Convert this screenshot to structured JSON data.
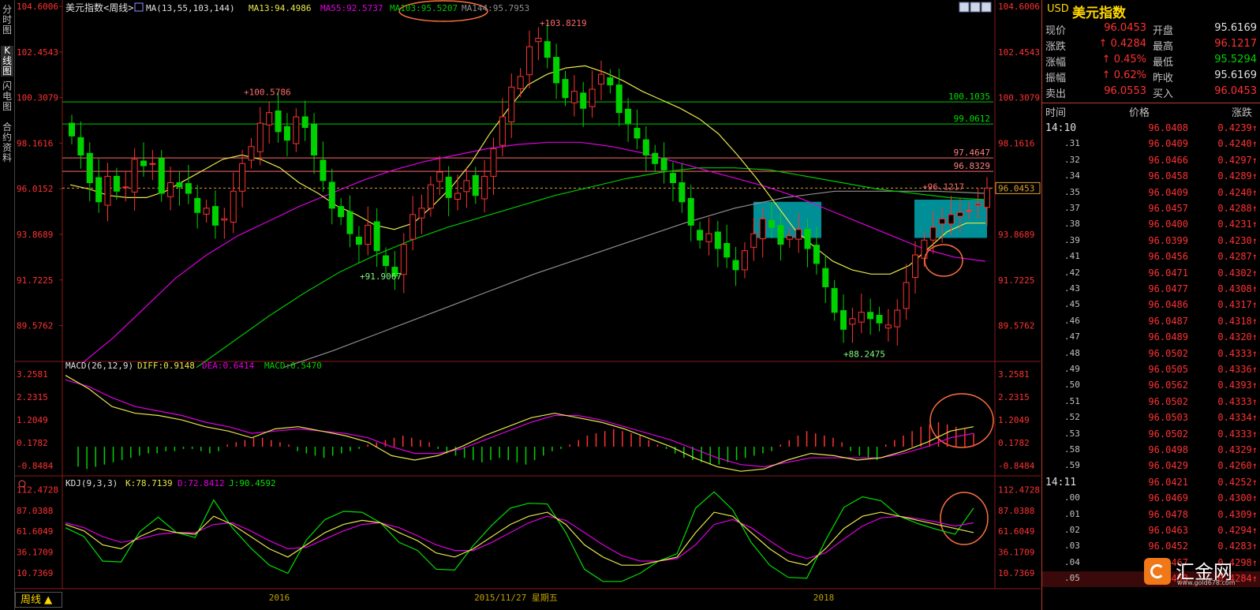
{
  "left_tabs": [
    "分时图",
    "K线图",
    "闪电图",
    "合约资料"
  ],
  "chart_data": [
    {
      "type": "candlestick",
      "header": {
        "title": "美元指数<周线>",
        "ma_label": "MA(13,55,103,144)",
        "ma13": "MA13:94.4986",
        "ma55": "MA55:92.5737",
        "ma103": "MA103:95.5207",
        "ma144": "MA144:95.7953"
      },
      "y_ticks": [
        "104.6006",
        "102.4543",
        "100.3079",
        "98.1616",
        "96.0152",
        "93.8689",
        "91.7225",
        "89.5762"
      ],
      "ylim": [
        88.0,
        104.6006
      ],
      "x_labels": [
        "2016",
        "2015/11/27 星期五",
        "2018"
      ],
      "hlines": [
        "100.1035",
        "99.0612",
        "97.4647",
        "96.8329"
      ],
      "current_price": "96.0453",
      "annotations": [
        "103.8219",
        "100.5786",
        "91.9067",
        "88.2475",
        "96.1217"
      ],
      "closes": [
        98.5,
        97.6,
        96.3,
        95.4,
        96.6,
        95.9,
        96.1,
        97.4,
        97.1,
        97.2,
        95.8,
        96.3,
        96.1,
        95.8,
        94.9,
        95.1,
        94.3,
        94.6,
        95.9,
        97.2,
        98.0,
        99.1,
        99.6,
        98.7,
        98.3,
        99.4,
        98.9,
        97.6,
        96.4,
        95.1,
        94.7,
        93.9,
        93.4,
        94.3,
        93.1,
        92.4,
        91.9,
        93.4,
        94.8,
        95.1,
        96.2,
        96.8,
        95.6,
        95.8,
        96.4,
        95.7,
        96.6,
        97.9,
        99.4,
        100.8,
        101.3,
        102.7,
        103.1,
        102.2,
        101.0,
        100.3,
        100.6,
        99.8,
        100.7,
        101.4,
        100.9,
        99.6,
        99.1,
        98.4,
        97.6,
        97.2,
        96.9,
        96.3,
        95.4,
        94.3,
        93.6,
        93.9,
        93.2,
        92.8,
        92.2,
        93.1,
        93.9,
        94.6,
        94.2,
        93.4,
        93.8,
        94.1,
        93.2,
        92.5,
        91.4,
        90.2,
        89.4,
        89.9,
        90.2,
        89.9,
        89.7,
        89.6,
        90.3,
        91.6,
        92.9,
        93.6,
        94.2,
        94.6,
        94.8,
        94.9,
        95.0,
        95.3,
        96.0453
      ],
      "ma13_pts": [
        96.2,
        96.0,
        95.7,
        95.6,
        95.6,
        95.9,
        96.4,
        96.9,
        97.4,
        97.6,
        97.4,
        97.0,
        96.3,
        95.8,
        95.2,
        94.8,
        94.3,
        94.1,
        94.4,
        95.2,
        96.1,
        97.2,
        98.6,
        99.8,
        100.9,
        101.4,
        101.7,
        101.8,
        101.5,
        101.1,
        100.6,
        100.2,
        99.8,
        99.3,
        98.6,
        97.6,
        96.5,
        95.3,
        94.1,
        93.3,
        92.6,
        92.2,
        92.0,
        92.0,
        92.4,
        93.2,
        94.0,
        94.4,
        94.4
      ],
      "ma55_pts": [
        87.8,
        89.0,
        90.4,
        91.8,
        92.9,
        93.8,
        94.5,
        95.2,
        95.8,
        96.4,
        96.9,
        97.3,
        97.6,
        97.9,
        98.1,
        98.2,
        98.2,
        98.0,
        97.7,
        97.3,
        96.9,
        96.5,
        96.1,
        95.6,
        95.0,
        94.4,
        93.8,
        93.2,
        92.8,
        92.6
      ],
      "ma103_pts": [
        87.6,
        88.8,
        90.0,
        91.1,
        92.1,
        92.9,
        93.6,
        94.2,
        94.7,
        95.2,
        95.7,
        96.1,
        96.5,
        96.8,
        97.0,
        97.0,
        96.9,
        96.6,
        96.3,
        96.0,
        95.8,
        95.6,
        95.5
      ],
      "ma144_pts": [
        87.6,
        88.4,
        89.3,
        90.2,
        91.1,
        92.0,
        92.8,
        93.6,
        94.4,
        95.1,
        95.6,
        95.9,
        95.9,
        95.9,
        95.8
      ]
    },
    {
      "type": "macd",
      "header": {
        "label": "MACD(26,12,9)",
        "diff": "DIFF:0.9148",
        "dea": "DEA:0.6414",
        "macd": "MACD:0.5470"
      },
      "y_ticks": [
        "3.2581",
        "2.2315",
        "1.2049",
        "0.1782",
        "-0.8484"
      ],
      "ylim": [
        -1.2,
        3.4
      ],
      "diff_pts": [
        3.2,
        2.6,
        1.8,
        1.5,
        1.4,
        1.2,
        0.9,
        0.7,
        0.4,
        0.8,
        0.9,
        0.7,
        0.5,
        0.2,
        -0.4,
        -0.6,
        -0.4,
        0.0,
        0.5,
        0.9,
        1.3,
        1.5,
        1.3,
        1.1,
        0.8,
        0.4,
        0.0,
        -0.5,
        -0.9,
        -1.1,
        -1.0,
        -0.6,
        -0.3,
        -0.4,
        -0.6,
        -0.5,
        -0.2,
        0.2,
        0.7,
        0.9
      ],
      "dea_pts": [
        3.0,
        2.7,
        2.2,
        1.8,
        1.6,
        1.4,
        1.1,
        0.9,
        0.6,
        0.7,
        0.8,
        0.7,
        0.6,
        0.4,
        0.0,
        -0.3,
        -0.3,
        -0.1,
        0.3,
        0.7,
        1.1,
        1.4,
        1.4,
        1.2,
        0.9,
        0.6,
        0.3,
        -0.1,
        -0.5,
        -0.8,
        -0.9,
        -0.7,
        -0.5,
        -0.5,
        -0.5,
        -0.5,
        -0.3,
        0.0,
        0.4,
        0.6
      ],
      "hist": [
        -0.9,
        -1.0,
        -0.9,
        -0.8,
        -0.7,
        -0.6,
        -0.5,
        -0.4,
        -0.3,
        -0.3,
        -0.2,
        -0.2,
        -0.1,
        -0.1,
        -0.2,
        -0.3,
        -0.2,
        0.1,
        0.2,
        0.3,
        0.4,
        0.4,
        0.3,
        0.2,
        0.1,
        -0.2,
        -0.3,
        -0.4,
        -0.5,
        -0.4,
        -0.3,
        -0.2,
        -0.1,
        0.1,
        0.2,
        0.3,
        0.4,
        0.5,
        0.4,
        0.3,
        0.2,
        -0.1,
        -0.3,
        -0.4,
        -0.5,
        -0.6,
        -0.7,
        -0.6,
        -0.5,
        -0.6,
        -0.7,
        -0.8,
        -0.6,
        -0.4,
        -0.2,
        -0.1,
        0.1,
        0.3,
        0.5,
        0.6,
        0.7,
        0.8,
        0.7,
        0.6,
        0.5,
        0.3,
        0.1,
        -0.1,
        -0.3,
        -0.5,
        -0.6,
        -0.7,
        -0.8,
        -0.8,
        -0.7,
        -0.6,
        -0.5,
        -0.4,
        -0.3,
        -0.2,
        0.1,
        0.3,
        0.5,
        0.7,
        0.6,
        0.5,
        0.4,
        0.2,
        -0.2,
        -0.4,
        -0.5,
        -0.6,
        0.1,
        0.3,
        0.5,
        0.7,
        0.9,
        1.0,
        1.1,
        1.0,
        0.9,
        0.8,
        0.6
      ]
    },
    {
      "type": "kdj",
      "header": {
        "label": "KDJ(9,3,3)",
        "k": "K:78.7139",
        "d": "D:72.8412",
        "j": "J:90.4592"
      },
      "y_ticks": [
        "112.4728",
        "87.0388",
        "61.6049",
        "36.1709",
        "10.7369"
      ],
      "ylim": [
        -5,
        118
      ],
      "k_pts": [
        70,
        62,
        45,
        40,
        55,
        65,
        60,
        58,
        80,
        70,
        55,
        40,
        30,
        45,
        60,
        70,
        75,
        72,
        60,
        50,
        35,
        30,
        40,
        55,
        70,
        80,
        85,
        70,
        45,
        30,
        20,
        20,
        25,
        30,
        60,
        85,
        80,
        60,
        40,
        25,
        20,
        40,
        65,
        80,
        85,
        80,
        75,
        70,
        65,
        60
      ],
      "d_pts": [
        72,
        66,
        55,
        48,
        52,
        58,
        60,
        60,
        70,
        72,
        62,
        50,
        40,
        42,
        52,
        62,
        70,
        72,
        66,
        56,
        45,
        38,
        38,
        48,
        60,
        72,
        80,
        75,
        60,
        45,
        32,
        25,
        25,
        28,
        45,
        70,
        76,
        66,
        50,
        35,
        28,
        35,
        52,
        68,
        78,
        80,
        77,
        73,
        68,
        72
      ],
      "j_pts": [
        66,
        55,
        25,
        24,
        61,
        79,
        60,
        54,
        100,
        66,
        41,
        20,
        10,
        51,
        76,
        86,
        85,
        72,
        48,
        38,
        15,
        14,
        44,
        69,
        90,
        96,
        95,
        60,
        15,
        0,
        0,
        10,
        25,
        34,
        90,
        110,
        88,
        48,
        20,
        5,
        4,
        50,
        91,
        104,
        99,
        80,
        71,
        64,
        58,
        90
      ]
    }
  ],
  "quote_panel": {
    "symbol": "USD",
    "name": "美元指数",
    "rows": [
      {
        "l1": "现价",
        "v1": "96.0453",
        "c1": "red",
        "l2": "开盘",
        "v2": "95.6169",
        "c2": "white"
      },
      {
        "l1": "涨跌",
        "v1": "↑ 0.4284",
        "c1": "red",
        "l2": "最高",
        "v2": "96.1217",
        "c2": "red"
      },
      {
        "l1": "涨幅",
        "v1": "↑ 0.45%",
        "c1": "red",
        "l2": "最低",
        "v2": "95.5294",
        "c2": "green"
      },
      {
        "l1": "振幅",
        "v1": "↑ 0.62%",
        "c1": "red",
        "l2": "昨收",
        "v2": "95.6169",
        "c2": "white"
      },
      {
        "l1": "卖出",
        "v1": "96.0553",
        "c1": "red",
        "l2": "买入",
        "v2": "96.0453",
        "c2": "red"
      }
    ],
    "table_headers": [
      "时间",
      "价格",
      "涨跌"
    ],
    "ticks": [
      {
        "t": "14:10",
        "p": "96.0408",
        "c": "0.4239↑"
      },
      {
        "t": ".31",
        "p": "96.0409",
        "c": "0.4240↑"
      },
      {
        "t": ".32",
        "p": "96.0466",
        "c": "0.4297↑"
      },
      {
        "t": ".34",
        "p": "96.0458",
        "c": "0.4289↑"
      },
      {
        "t": ".35",
        "p": "96.0409",
        "c": "0.4240↑"
      },
      {
        "t": ".37",
        "p": "96.0457",
        "c": "0.4288↑"
      },
      {
        "t": ".38",
        "p": "96.0400",
        "c": "0.4231↑"
      },
      {
        "t": ".39",
        "p": "96.0399",
        "c": "0.4230↑"
      },
      {
        "t": ".41",
        "p": "96.0456",
        "c": "0.4287↑"
      },
      {
        "t": ".42",
        "p": "96.0471",
        "c": "0.4302↑"
      },
      {
        "t": ".43",
        "p": "96.0477",
        "c": "0.4308↑"
      },
      {
        "t": ".45",
        "p": "96.0486",
        "c": "0.4317↑"
      },
      {
        "t": ".46",
        "p": "96.0487",
        "c": "0.4318↑"
      },
      {
        "t": ".47",
        "p": "96.0489",
        "c": "0.4320↑"
      },
      {
        "t": ".48",
        "p": "96.0502",
        "c": "0.4333↑"
      },
      {
        "t": ".49",
        "p": "96.0505",
        "c": "0.4336↑"
      },
      {
        "t": ".50",
        "p": "96.0562",
        "c": "0.4393↑"
      },
      {
        "t": ".51",
        "p": "96.0502",
        "c": "0.4333↑"
      },
      {
        "t": ".52",
        "p": "96.0503",
        "c": "0.4334↑"
      },
      {
        "t": ".53",
        "p": "96.0502",
        "c": "0.4333↑"
      },
      {
        "t": ".58",
        "p": "96.0498",
        "c": "0.4329↑"
      },
      {
        "t": ".59",
        "p": "96.0429",
        "c": "0.4260↑"
      },
      {
        "t": "14:11",
        "p": "96.0421",
        "c": "0.4252↑"
      },
      {
        "t": ".00",
        "p": "96.0469",
        "c": "0.4300↑"
      },
      {
        "t": ".01",
        "p": "96.0478",
        "c": "0.4309↑"
      },
      {
        "t": ".02",
        "p": "96.0463",
        "c": "0.4294↑"
      },
      {
        "t": ".03",
        "p": "96.0452",
        "c": "0.4283↑"
      },
      {
        "t": ".04",
        "p": "96.0467",
        "c": "0.4298↑"
      },
      {
        "t": ".05",
        "p": "96.0453",
        "c": "0.4284↑"
      }
    ]
  },
  "period_button": "周线 ▲",
  "logo": {
    "text": "汇金网",
    "url_text": "www.gold678.com"
  },
  "colors": {
    "up": "#ff3232",
    "down": "#00d200",
    "ma13": "#e8e84a",
    "ma55": "#e000e0",
    "ma103": "#00c800",
    "ma144": "#909090",
    "teal": "#00a8b0"
  }
}
